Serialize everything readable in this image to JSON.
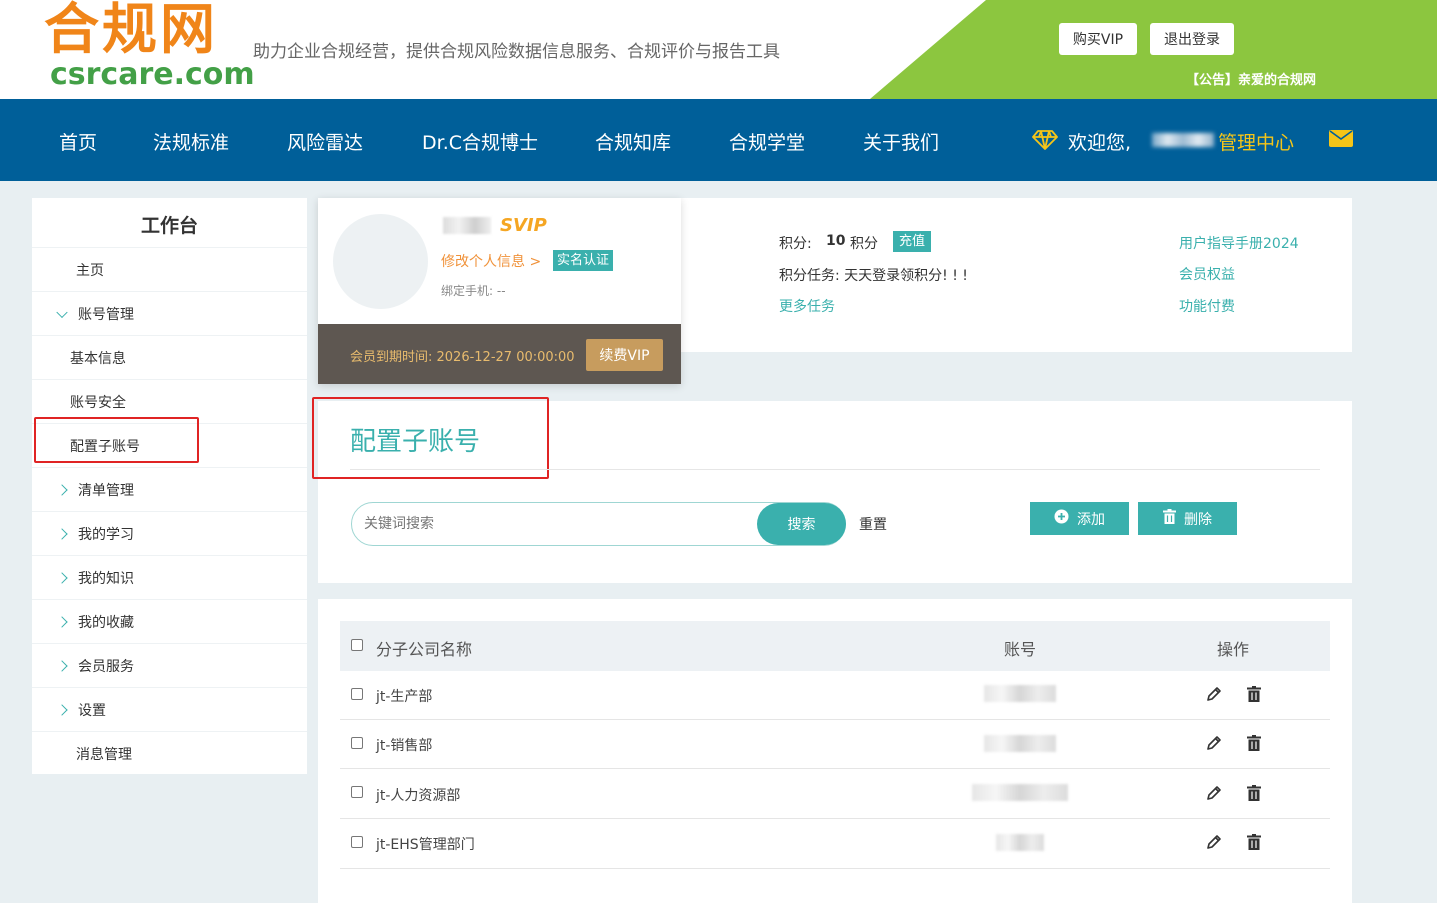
{
  "header": {
    "logo_cn": "合规网",
    "logo_en": "csrcare.com",
    "slogan": "助力企业合规经营，提供合规风险数据信息服务、合规评价与报告工具",
    "buy_vip": "购买VIP",
    "logout": "退出登录",
    "notice": "【公告】亲爱的合规网"
  },
  "nav": {
    "items": [
      "首页",
      "法规标准",
      "风险雷达",
      "Dr.C合规博士",
      "合规知库",
      "合规学堂",
      "关于我们"
    ],
    "welcome": "欢迎您,",
    "management": "管理中心"
  },
  "sidebar": {
    "title": "工作台",
    "items": [
      {
        "label": "主页"
      },
      {
        "label": "账号管理"
      },
      {
        "label": "基本信息"
      },
      {
        "label": "账号安全"
      },
      {
        "label": "配置子账号"
      },
      {
        "label": "清单管理"
      },
      {
        "label": "我的学习"
      },
      {
        "label": "我的知识"
      },
      {
        "label": "我的收藏"
      },
      {
        "label": "会员服务"
      },
      {
        "label": "设置"
      },
      {
        "label": "消息管理"
      }
    ]
  },
  "profile": {
    "level": "SVIP",
    "edit_link": "修改个人信息 >",
    "realname_badge": "实名认证",
    "phone_label": "绑定手机: --",
    "expiry": "会员到期时间: 2026-12-27 00:00:00",
    "renew": "续费VIP",
    "points_label": "积分:",
    "points_value": "10",
    "points_unit": "积分",
    "recharge": "充值",
    "task": "积分任务: 天天登录领积分! ! !",
    "more_tasks": "更多任务",
    "links": [
      "用户指导手册2024",
      "会员权益",
      "功能付费"
    ]
  },
  "config": {
    "title": "配置子账号",
    "search_placeholder": "关键词搜索",
    "search_button": "搜索",
    "reset": "重置",
    "add": "添加",
    "delete": "删除"
  },
  "table": {
    "headers": [
      "分子公司名称",
      "账号",
      "操作"
    ],
    "rows": [
      {
        "name": "jt-生产部"
      },
      {
        "name": "jt-销售部"
      },
      {
        "name": "jt-人力资源部"
      },
      {
        "name": "jt-EHS管理部门"
      }
    ]
  },
  "colors": {
    "brand_orange": "#f08519",
    "nav_blue": "#005f99",
    "header_green": "#8cc63f",
    "teal": "#3ab0ad",
    "highlight_red": "#e02424"
  }
}
